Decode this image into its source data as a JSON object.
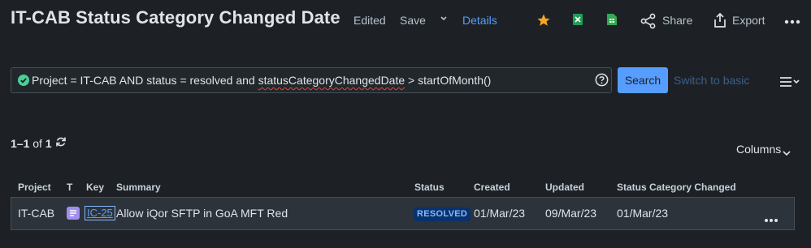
{
  "header": {
    "title": "IT-CAB Status Category Changed Date",
    "edited": "Edited",
    "save": "Save",
    "details": "Details",
    "share": "Share",
    "export": "Export"
  },
  "search": {
    "jql_prefix": "Project = IT-CAB AND status = resolved and ",
    "jql_field": "statusCategoryChangedDate",
    "jql_suffix": " > startOfMonth()",
    "search_button": "Search",
    "switch_basic": "Switch to basic"
  },
  "results": {
    "range": "1–1",
    "of": "of",
    "total": "1",
    "columns_button": "Columns"
  },
  "table": {
    "headers": [
      "Project",
      "T",
      "Key",
      "Summary",
      "Status",
      "Created",
      "Updated",
      "Status Category Changed"
    ],
    "rows": [
      {
        "project": "IT-CAB",
        "key": "IC-25",
        "summary": "Allow iQor SFTP in GoA MFT Red",
        "status": "RESOLVED",
        "created": "01/Mar/23",
        "updated": "09/Mar/23",
        "status_category_changed": "01/Mar/23"
      }
    ]
  },
  "colors": {
    "background": "#1d2125",
    "accent": "#579dff",
    "star": "#f5a623",
    "excel": "#1f9d55",
    "sheets": "#34a853",
    "check": "#4bce97",
    "status_lozenge_bg": "#09326c",
    "status_lozenge_text": "#85b8ff"
  },
  "icons": [
    "chevron-down-icon",
    "star-icon",
    "excel-icon",
    "google-sheets-icon",
    "share-icon",
    "export-icon",
    "more-icon",
    "check-circle-icon",
    "help-icon",
    "menu-icon",
    "refresh-icon",
    "story-type-icon"
  ]
}
